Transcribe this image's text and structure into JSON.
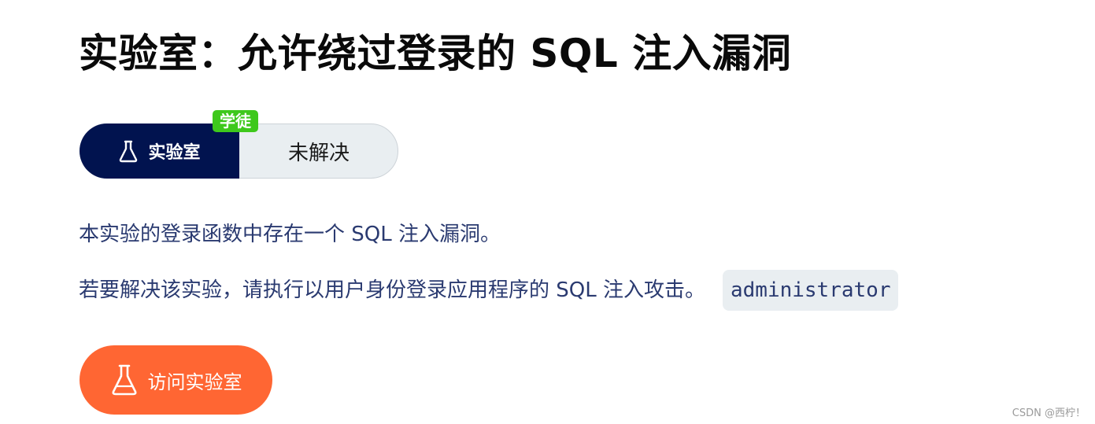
{
  "page": {
    "title": "实验室：允许绕过登录的 SQL 注入漏洞"
  },
  "lab_status": {
    "level_badge": "学徒",
    "lab_label": "实验室",
    "status": "未解决",
    "icon": "flask-icon",
    "colors": {
      "pill": "#01134f",
      "badge": "#3ec81c",
      "status_bg": "#e9eef1"
    }
  },
  "description": {
    "line1": "本实验的登录函数中存在一个 SQL 注入漏洞。",
    "line2": "若要解决该实验，请执行以用户身份登录应用程序的 SQL 注入攻击。",
    "username": "administrator"
  },
  "access_button": {
    "label": "访问实验室",
    "icon": "flask-icon",
    "color": "#ff6633"
  },
  "watermark": "CSDN @西柠！"
}
